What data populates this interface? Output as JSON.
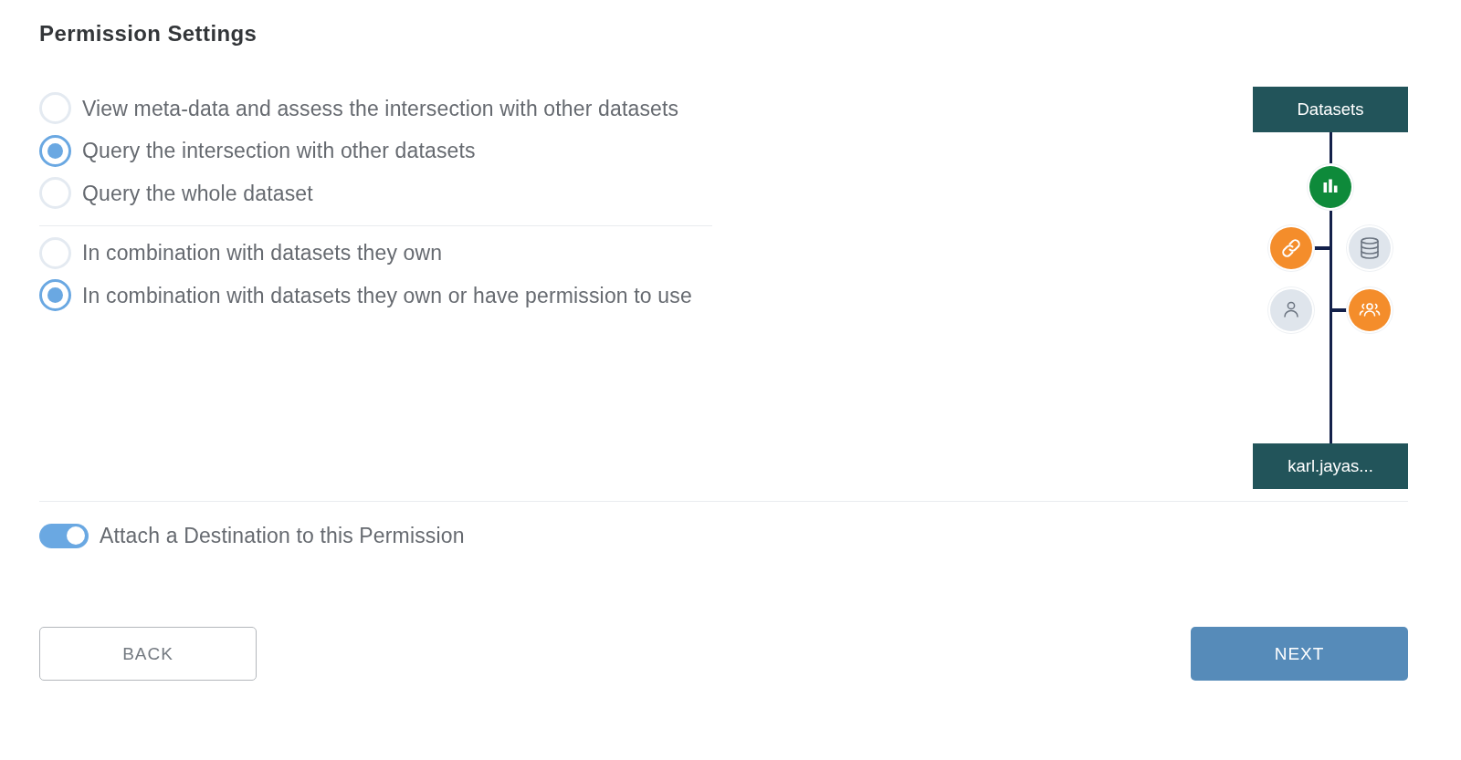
{
  "title": "Permission Settings",
  "access_options": [
    {
      "label": "View meta-data and assess the intersection with other datasets",
      "selected": false
    },
    {
      "label": "Query the intersection with other datasets",
      "selected": true
    },
    {
      "label": "Query the whole dataset",
      "selected": false
    }
  ],
  "scope_options": [
    {
      "label": "In combination with datasets they own",
      "selected": false
    },
    {
      "label": "In combination with datasets they own or have permission to use",
      "selected": true
    }
  ],
  "diagram": {
    "top_label": "Datasets",
    "bottom_label": "karl.jayas...",
    "nodes": [
      {
        "kind": "chart",
        "color": "#0e8a3a"
      },
      {
        "kind": "link",
        "color": "#f48d2b",
        "linked": true
      },
      {
        "kind": "database",
        "color": "#dfe5ec",
        "linked": false
      },
      {
        "kind": "person",
        "color": "#dfe5ec",
        "linked": false
      },
      {
        "kind": "group",
        "color": "#f48d2b",
        "linked": true
      }
    ]
  },
  "toggle": {
    "label": "Attach a Destination to this Permission",
    "on": true
  },
  "buttons": [
    {
      "kind": "secondary",
      "label": "BACK"
    },
    {
      "kind": "primary",
      "label": "NEXT"
    }
  ]
}
